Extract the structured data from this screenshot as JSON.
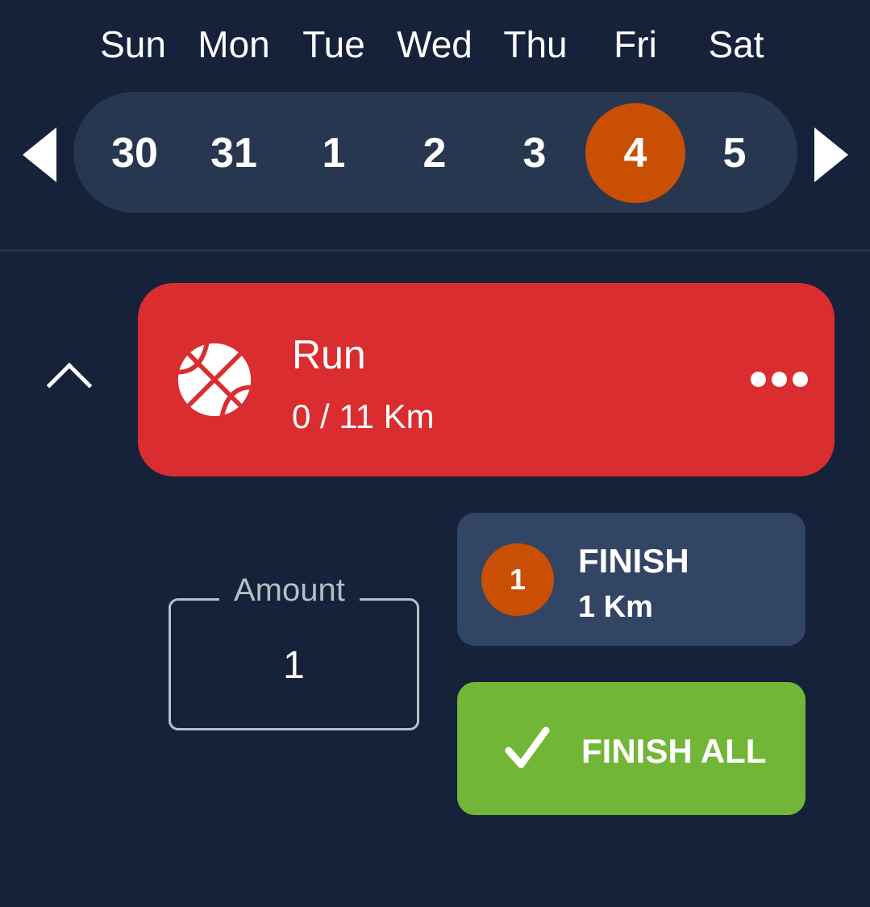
{
  "calendar": {
    "weekdays": [
      "Sun",
      "Mon",
      "Tue",
      "Wed",
      "Thu",
      "Fri",
      "Sat"
    ],
    "dates": [
      "30",
      "31",
      "1",
      "2",
      "3",
      "4",
      "5"
    ],
    "selected_index": 5,
    "prev_icon": "triangle-left-icon",
    "next_icon": "triangle-right-icon"
  },
  "task": {
    "title": "Run",
    "progress": "0 / 11 Km",
    "icon": "basketball-icon",
    "menu_icon": "more-horizontal-icon",
    "collapse_icon": "chevron-up-icon"
  },
  "amount": {
    "label": "Amount",
    "value": "1"
  },
  "finish": {
    "badge": "1",
    "label": "FINISH",
    "sub": "1 Km"
  },
  "finish_all": {
    "label": "FINISH ALL",
    "icon": "check-icon"
  },
  "colors": {
    "background": "#15223a",
    "date_bar": "#27374f",
    "selected": "#c84f04",
    "task_card": "#d92d30",
    "finish_button": "#324564",
    "finish_all_button": "#72b637"
  }
}
